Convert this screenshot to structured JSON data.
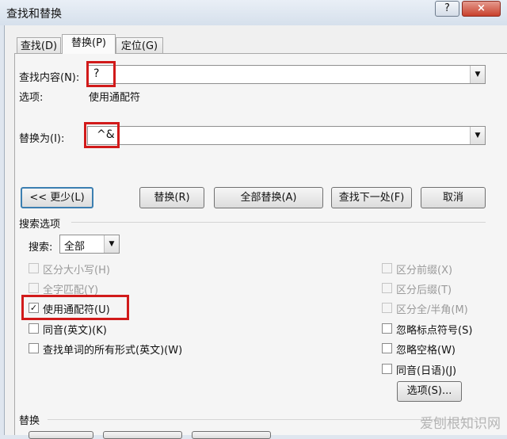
{
  "window": {
    "title": "查找和替换",
    "help": "?",
    "close": "×"
  },
  "tabs": [
    {
      "label": "查找(D)"
    },
    {
      "label": "替换(P)"
    },
    {
      "label": "定位(G)"
    }
  ],
  "find": {
    "label": "查找内容(N):",
    "value": "?"
  },
  "options_info": {
    "label": "选项:",
    "value": "使用通配符"
  },
  "replace": {
    "label": "替换为(I):",
    "value": "^&"
  },
  "buttons": {
    "less": "<< 更少(L)",
    "replace": "替换(R)",
    "replace_all": "全部替换(A)",
    "find_next": "查找下一处(F)",
    "cancel": "取消",
    "format": "选项(S)..."
  },
  "search_options": {
    "heading": "搜索选项",
    "search_label": "搜索:",
    "search_value": "全部"
  },
  "checkboxes_left": [
    {
      "label": "区分大小写(H)",
      "checked": false,
      "disabled": true
    },
    {
      "label": "全字匹配(Y)",
      "checked": false,
      "disabled": true
    },
    {
      "label": "使用通配符(U)",
      "checked": true,
      "disabled": false
    },
    {
      "label": "同音(英文)(K)",
      "checked": false,
      "disabled": false
    },
    {
      "label": "查找单词的所有形式(英文)(W)",
      "checked": false,
      "disabled": false
    }
  ],
  "checkboxes_right": [
    {
      "label": "区分前缀(X)",
      "checked": false,
      "disabled": true
    },
    {
      "label": "区分后缀(T)",
      "checked": false,
      "disabled": true
    },
    {
      "label": "区分全/半角(M)",
      "checked": false,
      "disabled": true
    },
    {
      "label": "忽略标点符号(S)",
      "checked": false,
      "disabled": false
    },
    {
      "label": "忽略空格(W)",
      "checked": false,
      "disabled": false
    },
    {
      "label": "同音(日语)(J)",
      "checked": false,
      "disabled": false
    }
  ],
  "replace_section": {
    "heading": "替换"
  },
  "watermark": "爱刨根知识网",
  "colors": {
    "highlight": "#d11a1a",
    "accent": "#3c7fb1"
  }
}
